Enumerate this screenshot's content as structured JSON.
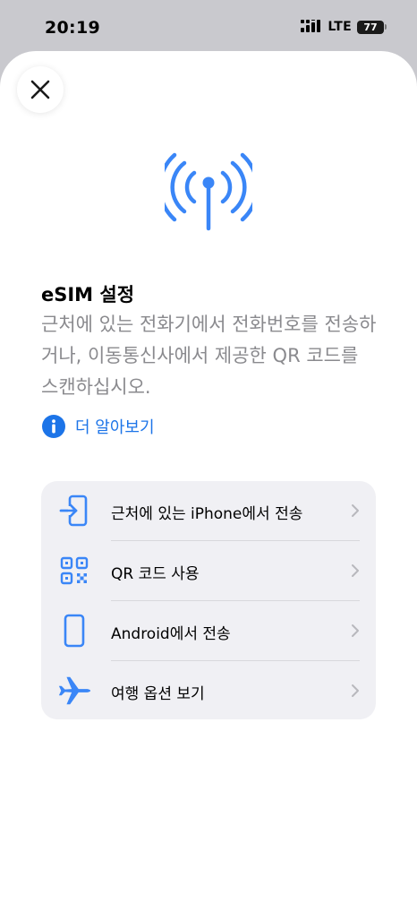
{
  "status_bar": {
    "time": "20:19",
    "network": "LTE",
    "battery": "77"
  },
  "sheet": {
    "title": "eSIM 설정",
    "description": "근처에 있는 전화기에서 전화번호를 전송하거나, 이동통신사에서 제공한 QR 코드를 스캔하십시오.",
    "learn_more": "더 알아보기",
    "options": [
      {
        "label": "근처에 있는 iPhone에서 전송",
        "icon": "transfer-in-icon"
      },
      {
        "label": "QR 코드 사용",
        "icon": "qr-code-icon"
      },
      {
        "label": "Android에서 전송",
        "icon": "android-phone-icon"
      },
      {
        "label": "여행 옵션 보기",
        "icon": "airplane-icon"
      }
    ]
  },
  "colors": {
    "accent": "#3a86f7",
    "link": "#1c74e8",
    "secondary_text": "#8a8a8e",
    "card_background": "#f0f0f4",
    "backdrop": "#c9c9ce"
  }
}
